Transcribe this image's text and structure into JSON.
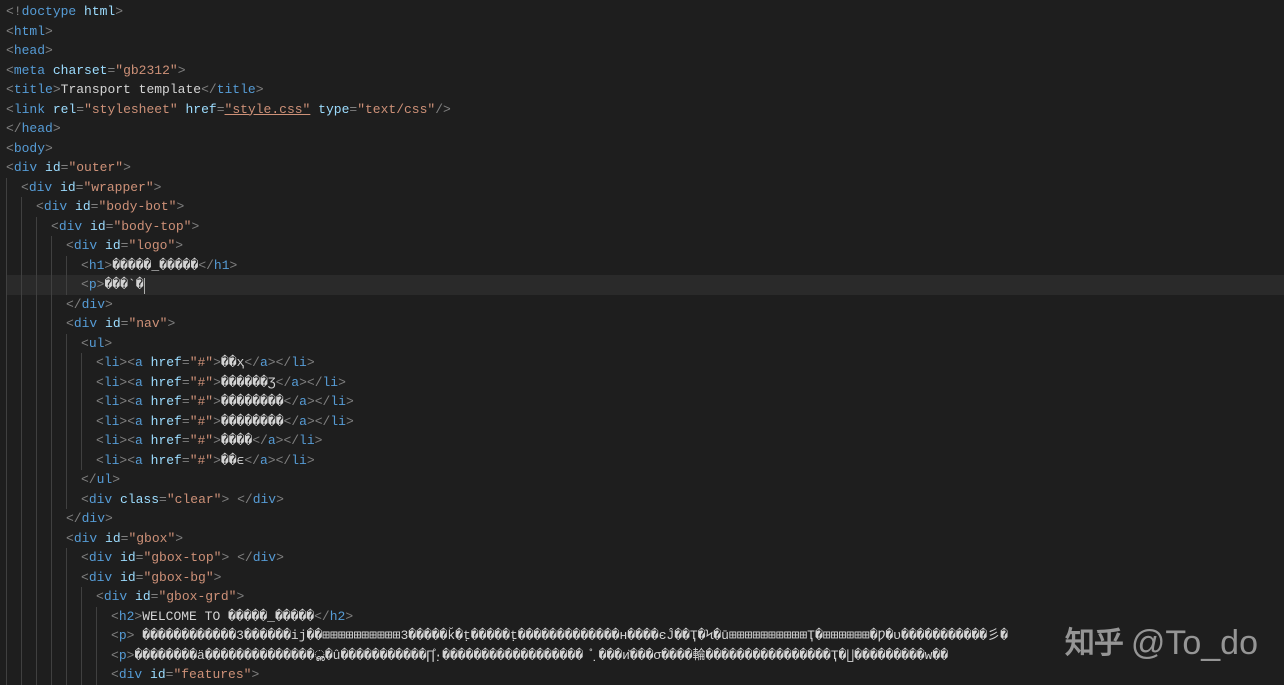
{
  "watermark": {
    "logo": "知乎",
    "handle": "@To_do"
  },
  "code": {
    "lines": [
      {
        "indent": 0,
        "tokens": [
          [
            "punct",
            "<!"
          ],
          [
            "tag",
            "doctype"
          ],
          [
            "text",
            " "
          ],
          [
            "attr",
            "html"
          ],
          [
            "punct",
            ">"
          ]
        ]
      },
      {
        "indent": 0,
        "tokens": [
          [
            "punct",
            "<"
          ],
          [
            "tag",
            "html"
          ],
          [
            "punct",
            ">"
          ]
        ]
      },
      {
        "indent": 0,
        "tokens": [
          [
            "punct",
            "<"
          ],
          [
            "tag",
            "head"
          ],
          [
            "punct",
            ">"
          ]
        ]
      },
      {
        "indent": 0,
        "tokens": [
          [
            "punct",
            "<"
          ],
          [
            "tag",
            "meta"
          ],
          [
            "text",
            " "
          ],
          [
            "attr",
            "charset"
          ],
          [
            "punct",
            "="
          ],
          [
            "str",
            "\"gb2312\""
          ],
          [
            "punct",
            ">"
          ]
        ]
      },
      {
        "indent": 0,
        "tokens": [
          [
            "punct",
            "<"
          ],
          [
            "tag",
            "title"
          ],
          [
            "punct",
            ">"
          ],
          [
            "text",
            "Transport template"
          ],
          [
            "punct",
            "</"
          ],
          [
            "tag",
            "title"
          ],
          [
            "punct",
            ">"
          ]
        ]
      },
      {
        "indent": 0,
        "tokens": [
          [
            "punct",
            "<"
          ],
          [
            "tag",
            "link"
          ],
          [
            "text",
            " "
          ],
          [
            "attr",
            "rel"
          ],
          [
            "punct",
            "="
          ],
          [
            "str",
            "\"stylesheet\""
          ],
          [
            "text",
            " "
          ],
          [
            "attr",
            "href"
          ],
          [
            "punct",
            "="
          ],
          [
            "str-u",
            "\"style.css\""
          ],
          [
            "text",
            " "
          ],
          [
            "attr",
            "type"
          ],
          [
            "punct",
            "="
          ],
          [
            "str",
            "\"text/css\""
          ],
          [
            "punct",
            "/"
          ],
          [
            "punct",
            ">"
          ]
        ]
      },
      {
        "indent": 0,
        "tokens": [
          [
            "punct",
            "</"
          ],
          [
            "tag",
            "head"
          ],
          [
            "punct",
            ">"
          ]
        ]
      },
      {
        "indent": 0,
        "tokens": [
          [
            "punct",
            "<"
          ],
          [
            "tag",
            "body"
          ],
          [
            "punct",
            ">"
          ]
        ]
      },
      {
        "indent": 0,
        "tokens": [
          [
            "punct",
            "<"
          ],
          [
            "tag",
            "div"
          ],
          [
            "text",
            " "
          ],
          [
            "attr",
            "id"
          ],
          [
            "punct",
            "="
          ],
          [
            "str",
            "\"outer\""
          ],
          [
            "punct",
            ">"
          ]
        ]
      },
      {
        "indent": 1,
        "tokens": [
          [
            "punct",
            "<"
          ],
          [
            "tag",
            "div"
          ],
          [
            "text",
            " "
          ],
          [
            "attr",
            "id"
          ],
          [
            "punct",
            "="
          ],
          [
            "str",
            "\"wrapper\""
          ],
          [
            "punct",
            ">"
          ]
        ]
      },
      {
        "indent": 2,
        "tokens": [
          [
            "punct",
            "<"
          ],
          [
            "tag",
            "div"
          ],
          [
            "text",
            " "
          ],
          [
            "attr",
            "id"
          ],
          [
            "punct",
            "="
          ],
          [
            "str",
            "\"body-bot\""
          ],
          [
            "punct",
            ">"
          ]
        ]
      },
      {
        "indent": 3,
        "tokens": [
          [
            "punct",
            "<"
          ],
          [
            "tag",
            "div"
          ],
          [
            "text",
            " "
          ],
          [
            "attr",
            "id"
          ],
          [
            "punct",
            "="
          ],
          [
            "str",
            "\"body-top\""
          ],
          [
            "punct",
            ">"
          ]
        ]
      },
      {
        "indent": 4,
        "tokens": [
          [
            "punct",
            "<"
          ],
          [
            "tag",
            "div"
          ],
          [
            "text",
            " "
          ],
          [
            "attr",
            "id"
          ],
          [
            "punct",
            "="
          ],
          [
            "str",
            "\"logo\""
          ],
          [
            "punct",
            ">"
          ]
        ]
      },
      {
        "indent": 5,
        "tokens": [
          [
            "punct",
            "<"
          ],
          [
            "tag",
            "h1"
          ],
          [
            "punct",
            ">"
          ],
          [
            "text",
            "�����_�����"
          ],
          [
            "punct",
            "</"
          ],
          [
            "tag",
            "h1"
          ],
          [
            "punct",
            ">"
          ]
        ]
      },
      {
        "indent": 5,
        "current": true,
        "tokens": [
          [
            "punct",
            "<"
          ],
          [
            "tag",
            "p"
          ],
          [
            "punct",
            ">"
          ],
          [
            "text",
            "���`�"
          ],
          [
            "cursor",
            ""
          ]
        ]
      },
      {
        "indent": 4,
        "tokens": [
          [
            "punct",
            "</"
          ],
          [
            "tag",
            "div"
          ],
          [
            "punct",
            ">"
          ]
        ]
      },
      {
        "indent": 4,
        "tokens": [
          [
            "punct",
            "<"
          ],
          [
            "tag",
            "div"
          ],
          [
            "text",
            " "
          ],
          [
            "attr",
            "id"
          ],
          [
            "punct",
            "="
          ],
          [
            "str",
            "\"nav\""
          ],
          [
            "punct",
            ">"
          ]
        ]
      },
      {
        "indent": 5,
        "tokens": [
          [
            "punct",
            "<"
          ],
          [
            "tag",
            "ul"
          ],
          [
            "punct",
            ">"
          ]
        ]
      },
      {
        "indent": 6,
        "tokens": [
          [
            "punct",
            "<"
          ],
          [
            "tag",
            "li"
          ],
          [
            "punct",
            "><"
          ],
          [
            "tag",
            "a"
          ],
          [
            "text",
            " "
          ],
          [
            "attr",
            "href"
          ],
          [
            "punct",
            "="
          ],
          [
            "str",
            "\"#\""
          ],
          [
            "punct",
            ">"
          ],
          [
            "text",
            "��ҳ"
          ],
          [
            "punct",
            "</"
          ],
          [
            "tag",
            "a"
          ],
          [
            "punct",
            "></"
          ],
          [
            "tag",
            "li"
          ],
          [
            "punct",
            ">"
          ]
        ]
      },
      {
        "indent": 6,
        "tokens": [
          [
            "punct",
            "<"
          ],
          [
            "tag",
            "li"
          ],
          [
            "punct",
            "><"
          ],
          [
            "tag",
            "a"
          ],
          [
            "text",
            " "
          ],
          [
            "attr",
            "href"
          ],
          [
            "punct",
            "="
          ],
          [
            "str",
            "\"#\""
          ],
          [
            "punct",
            ">"
          ],
          [
            "text",
            "������Ʒ"
          ],
          [
            "punct",
            "</"
          ],
          [
            "tag",
            "a"
          ],
          [
            "punct",
            "></"
          ],
          [
            "tag",
            "li"
          ],
          [
            "punct",
            ">"
          ]
        ]
      },
      {
        "indent": 6,
        "tokens": [
          [
            "punct",
            "<"
          ],
          [
            "tag",
            "li"
          ],
          [
            "punct",
            "><"
          ],
          [
            "tag",
            "a"
          ],
          [
            "text",
            " "
          ],
          [
            "attr",
            "href"
          ],
          [
            "punct",
            "="
          ],
          [
            "str",
            "\"#\""
          ],
          [
            "punct",
            ">"
          ],
          [
            "text",
            "��������"
          ],
          [
            "punct",
            "</"
          ],
          [
            "tag",
            "a"
          ],
          [
            "punct",
            "></"
          ],
          [
            "tag",
            "li"
          ],
          [
            "punct",
            ">"
          ]
        ]
      },
      {
        "indent": 6,
        "tokens": [
          [
            "punct",
            "<"
          ],
          [
            "tag",
            "li"
          ],
          [
            "punct",
            "><"
          ],
          [
            "tag",
            "a"
          ],
          [
            "text",
            " "
          ],
          [
            "attr",
            "href"
          ],
          [
            "punct",
            "="
          ],
          [
            "str",
            "\"#\""
          ],
          [
            "punct",
            ">"
          ],
          [
            "text",
            "��������"
          ],
          [
            "punct",
            "</"
          ],
          [
            "tag",
            "a"
          ],
          [
            "punct",
            "></"
          ],
          [
            "tag",
            "li"
          ],
          [
            "punct",
            ">"
          ]
        ]
      },
      {
        "indent": 6,
        "tokens": [
          [
            "punct",
            "<"
          ],
          [
            "tag",
            "li"
          ],
          [
            "punct",
            "><"
          ],
          [
            "tag",
            "a"
          ],
          [
            "text",
            " "
          ],
          [
            "attr",
            "href"
          ],
          [
            "punct",
            "="
          ],
          [
            "str",
            "\"#\""
          ],
          [
            "punct",
            ">"
          ],
          [
            "text",
            "����"
          ],
          [
            "punct",
            "</"
          ],
          [
            "tag",
            "a"
          ],
          [
            "punct",
            "></"
          ],
          [
            "tag",
            "li"
          ],
          [
            "punct",
            ">"
          ]
        ]
      },
      {
        "indent": 6,
        "tokens": [
          [
            "punct",
            "<"
          ],
          [
            "tag",
            "li"
          ],
          [
            "punct",
            "><"
          ],
          [
            "tag",
            "a"
          ],
          [
            "text",
            " "
          ],
          [
            "attr",
            "href"
          ],
          [
            "punct",
            "="
          ],
          [
            "str",
            "\"#\""
          ],
          [
            "punct",
            ">"
          ],
          [
            "text",
            "��ϵ"
          ],
          [
            "punct",
            "</"
          ],
          [
            "tag",
            "a"
          ],
          [
            "punct",
            "></"
          ],
          [
            "tag",
            "li"
          ],
          [
            "punct",
            ">"
          ]
        ]
      },
      {
        "indent": 5,
        "tokens": [
          [
            "punct",
            "</"
          ],
          [
            "tag",
            "ul"
          ],
          [
            "punct",
            ">"
          ]
        ]
      },
      {
        "indent": 5,
        "tokens": [
          [
            "punct",
            "<"
          ],
          [
            "tag",
            "div"
          ],
          [
            "text",
            " "
          ],
          [
            "attr",
            "class"
          ],
          [
            "punct",
            "="
          ],
          [
            "str",
            "\"clear\""
          ],
          [
            "punct",
            ">"
          ],
          [
            "text",
            " "
          ],
          [
            "punct",
            "</"
          ],
          [
            "tag",
            "div"
          ],
          [
            "punct",
            ">"
          ]
        ]
      },
      {
        "indent": 4,
        "tokens": [
          [
            "punct",
            "</"
          ],
          [
            "tag",
            "div"
          ],
          [
            "punct",
            ">"
          ]
        ]
      },
      {
        "indent": 4,
        "tokens": [
          [
            "punct",
            "<"
          ],
          [
            "tag",
            "div"
          ],
          [
            "text",
            " "
          ],
          [
            "attr",
            "id"
          ],
          [
            "punct",
            "="
          ],
          [
            "str",
            "\"gbox\""
          ],
          [
            "punct",
            ">"
          ]
        ]
      },
      {
        "indent": 5,
        "tokens": [
          [
            "punct",
            "<"
          ],
          [
            "tag",
            "div"
          ],
          [
            "text",
            " "
          ],
          [
            "attr",
            "id"
          ],
          [
            "punct",
            "="
          ],
          [
            "str",
            "\"gbox-top\""
          ],
          [
            "punct",
            ">"
          ],
          [
            "text",
            " "
          ],
          [
            "punct",
            "</"
          ],
          [
            "tag",
            "div"
          ],
          [
            "punct",
            ">"
          ]
        ]
      },
      {
        "indent": 5,
        "tokens": [
          [
            "punct",
            "<"
          ],
          [
            "tag",
            "div"
          ],
          [
            "text",
            " "
          ],
          [
            "attr",
            "id"
          ],
          [
            "punct",
            "="
          ],
          [
            "str",
            "\"gbox-bg\""
          ],
          [
            "punct",
            ">"
          ]
        ]
      },
      {
        "indent": 6,
        "tokens": [
          [
            "punct",
            "<"
          ],
          [
            "tag",
            "div"
          ],
          [
            "text",
            " "
          ],
          [
            "attr",
            "id"
          ],
          [
            "punct",
            "="
          ],
          [
            "str",
            "\"gbox-grd\""
          ],
          [
            "punct",
            ">"
          ]
        ]
      },
      {
        "indent": 7,
        "tokens": [
          [
            "punct",
            "<"
          ],
          [
            "tag",
            "h2"
          ],
          [
            "punct",
            ">"
          ],
          [
            "text",
            "WELCOME TO �����_�����"
          ],
          [
            "punct",
            "</"
          ],
          [
            "tag",
            "h2"
          ],
          [
            "punct",
            ">"
          ]
        ]
      },
      {
        "indent": 7,
        "tokens": [
          [
            "punct",
            "<"
          ],
          [
            "tag",
            "p"
          ],
          [
            "punct",
            ">"
          ],
          [
            "text",
            " ������������3������ij��⊞⊞⊞⊞⊞⊞⊞⊞⊞⊞3�����k̆�ṭ�����ṭ�������������н����єĴ��Ҭ�Ϟ�ū⊞⊞⊞⊞⊞⊞⊞⊞⊞⊞Ҭ�⊞⊞⊞⊞⊞⊞�Ƿ�ᴜ�����������彡�"
          ]
        ]
      },
      {
        "indent": 7,
        "tokens": [
          [
            "punct",
            "<"
          ],
          [
            "tag",
            "p"
          ],
          [
            "punct",
            ">"
          ],
          [
            "text",
            "��������ӓ��������������ൢ�û�����������∏̊·̣������������������ ̊ ̣���ᴎ̆���σ����輪����������������Ҭ�∐���������w��"
          ]
        ]
      },
      {
        "indent": 7,
        "tokens": [
          [
            "punct",
            "<"
          ],
          [
            "tag",
            "div"
          ],
          [
            "text",
            " "
          ],
          [
            "attr",
            "id"
          ],
          [
            "punct",
            "="
          ],
          [
            "str",
            "\"features\""
          ],
          [
            "punct",
            ">"
          ]
        ]
      }
    ]
  }
}
